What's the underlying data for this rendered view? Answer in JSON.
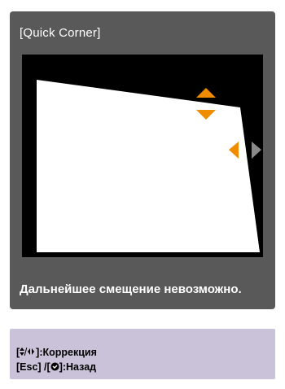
{
  "panel": {
    "title": "[Quick Corner]",
    "message": "Дальнейшее смещение невозможно.",
    "colors": {
      "panel_bg": "#595959",
      "canvas_bg": "#000000",
      "shape_fill": "#ffffff",
      "arrow_active": "#f08c00",
      "arrow_inactive": "#8a8a8a"
    },
    "icons": [
      "arrow-up-icon",
      "arrow-down-icon",
      "arrow-left-icon",
      "arrow-right-icon"
    ]
  },
  "help": {
    "line1_open": "[",
    "line1_icon": "◆/◆",
    "line1_text": "]:Коррекция",
    "line2_part1": "[Esc] /[",
    "line2_icon": "⏎",
    "line2_text": "]:Назад"
  }
}
